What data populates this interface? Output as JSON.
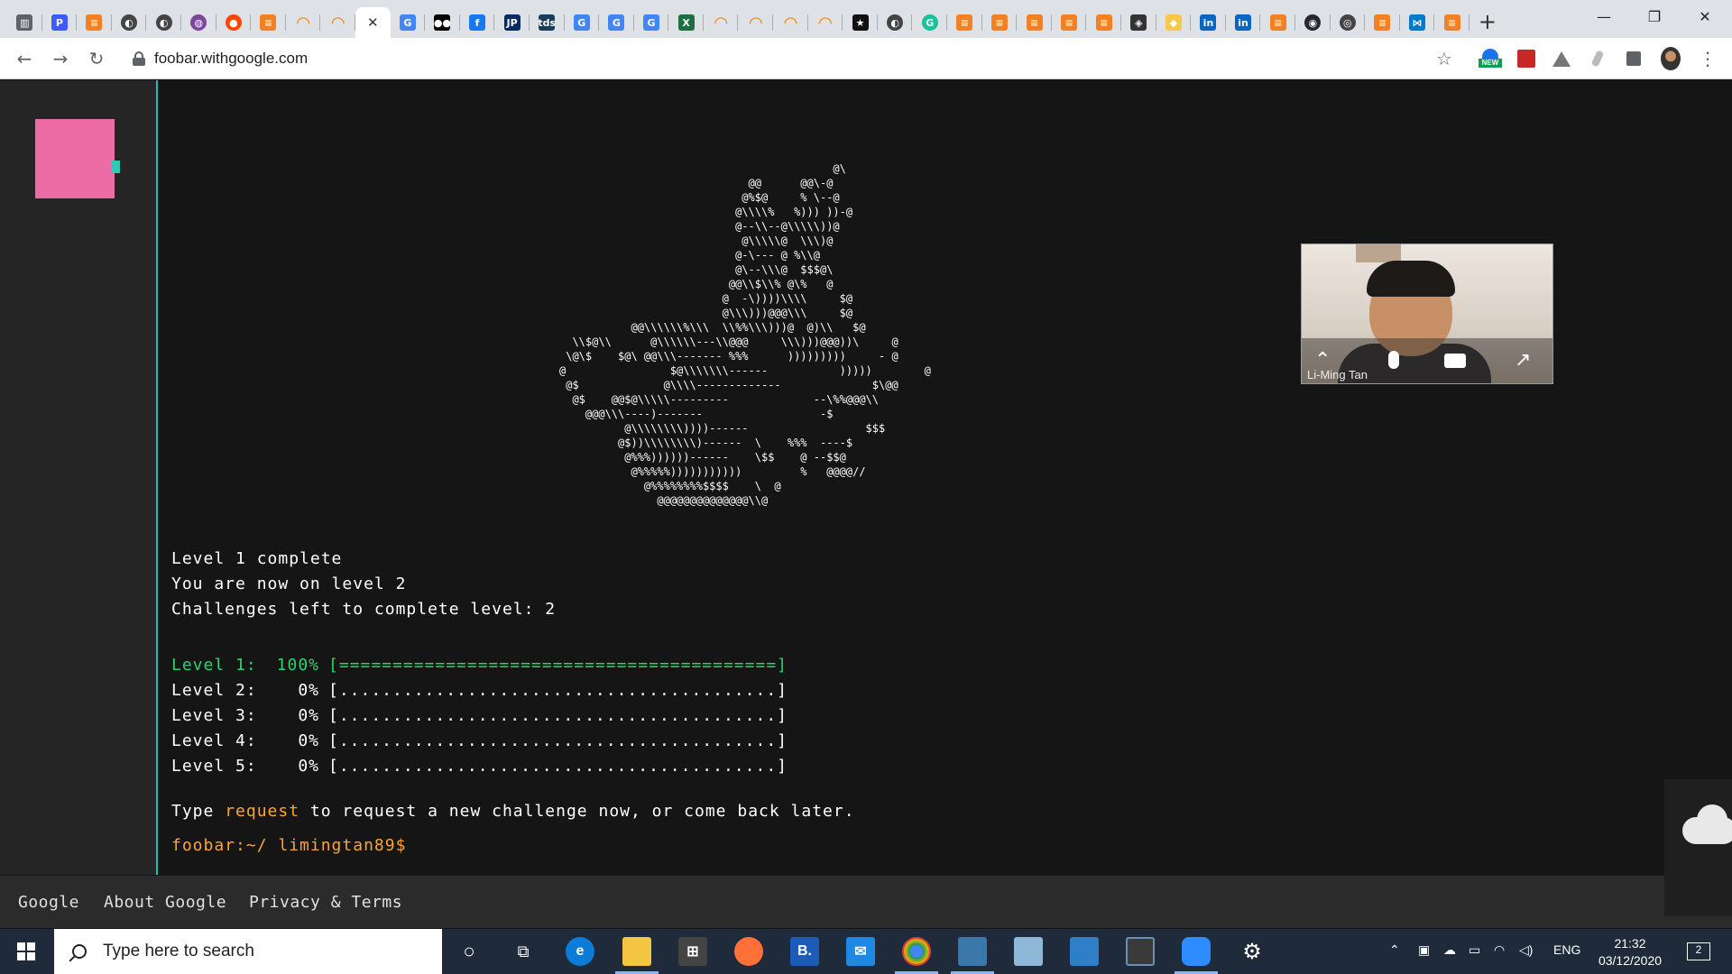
{
  "browser": {
    "url": "foobar.withgoogle.com",
    "active_tab_close": "✕",
    "new_tab": "+",
    "tabs": [
      {
        "icon": "reader-mode-icon",
        "glyph": "▥",
        "color": "#5f6368"
      },
      {
        "icon": "p-icon",
        "glyph": "P",
        "color": "#3d5afe"
      },
      {
        "icon": "stackoverflow-icon",
        "glyph": "≡",
        "color": "#f48024"
      },
      {
        "icon": "globe-icon",
        "glyph": "◐",
        "color": "#444444"
      },
      {
        "icon": "globe-icon",
        "glyph": "◐",
        "color": "#444444"
      },
      {
        "icon": "tor-icon",
        "glyph": "◍",
        "color": "#7d4698"
      },
      {
        "icon": "reddit-icon",
        "glyph": "●",
        "color": "#ff4500"
      },
      {
        "icon": "stackoverflow-icon",
        "glyph": "≡",
        "color": "#f48024"
      },
      {
        "icon": "loading-icon",
        "glyph": "◠",
        "color": "#f57c00"
      },
      {
        "icon": "loading-icon",
        "glyph": "◠",
        "color": "#f57c00"
      },
      {
        "icon": "active-tab",
        "glyph": "",
        "color": "#ffffff"
      },
      {
        "icon": "google-icon",
        "glyph": "G",
        "color": "#4285f4"
      },
      {
        "icon": "medium-icon",
        "glyph": "●●",
        "color": "#000000"
      },
      {
        "icon": "facebook-icon",
        "glyph": "f",
        "color": "#1877f2"
      },
      {
        "icon": "jp-icon",
        "glyph": "JP",
        "color": "#0a2a66"
      },
      {
        "icon": "tds-icon",
        "glyph": "tds",
        "color": "#1c3d5a"
      },
      {
        "icon": "google-icon",
        "glyph": "G",
        "color": "#4285f4"
      },
      {
        "icon": "google-icon",
        "glyph": "G",
        "color": "#4285f4"
      },
      {
        "icon": "google-icon",
        "glyph": "G",
        "color": "#4285f4"
      },
      {
        "icon": "excel-icon",
        "glyph": "X",
        "color": "#1d6f42"
      },
      {
        "icon": "loading-icon",
        "glyph": "◠",
        "color": "#f57c00"
      },
      {
        "icon": "loading-icon",
        "glyph": "◠",
        "color": "#f57c00"
      },
      {
        "icon": "loading-icon",
        "glyph": "◠",
        "color": "#f57c00"
      },
      {
        "icon": "loading-icon",
        "glyph": "◠",
        "color": "#f57c00"
      },
      {
        "icon": "star-icon",
        "glyph": "★",
        "color": "#111111"
      },
      {
        "icon": "globe-icon",
        "glyph": "◐",
        "color": "#444444"
      },
      {
        "icon": "grammarly-icon",
        "glyph": "G",
        "color": "#15c39a"
      },
      {
        "icon": "stackoverflow-icon",
        "glyph": "≡",
        "color": "#f48024"
      },
      {
        "icon": "stackoverflow-icon",
        "glyph": "≡",
        "color": "#f48024"
      },
      {
        "icon": "stackoverflow-icon",
        "glyph": "≡",
        "color": "#f48024"
      },
      {
        "icon": "stackoverflow-icon",
        "glyph": "≡",
        "color": "#f48024"
      },
      {
        "icon": "stackoverflow-icon",
        "glyph": "≡",
        "color": "#f48024"
      },
      {
        "icon": "diamond-icon",
        "glyph": "◈",
        "color": "#333333"
      },
      {
        "icon": "python-icon",
        "glyph": "◆",
        "color": "#f7c948"
      },
      {
        "icon": "linkedin-icon",
        "glyph": "in",
        "color": "#0a66c2"
      },
      {
        "icon": "linkedin-icon",
        "glyph": "in",
        "color": "#0a66c2"
      },
      {
        "icon": "stackoverflow-icon",
        "glyph": "≡",
        "color": "#f48024"
      },
      {
        "icon": "github-icon",
        "glyph": "◉",
        "color": "#24292e"
      },
      {
        "icon": "spiral-icon",
        "glyph": "◎",
        "color": "#444444"
      },
      {
        "icon": "stackoverflow-icon",
        "glyph": "≡",
        "color": "#f48024"
      },
      {
        "icon": "vscode-icon",
        "glyph": "⋈",
        "color": "#007acc"
      },
      {
        "icon": "stackoverflow-icon",
        "glyph": "≡",
        "color": "#f48024"
      }
    ],
    "window_controls": {
      "minimize": "—",
      "restore": "❐",
      "close": "✕"
    }
  },
  "toolbar": {
    "back": "←",
    "forward": "→",
    "reload": "↻",
    "star": "☆",
    "ext_new_badge": "NEW",
    "menu": "⋮"
  },
  "terminal": {
    "ascii_art": "                                          @\\\n                             @@      @@\\-@\n                            @%$@     % \\--@\n                           @\\\\\\\\%   %))) ))-@\n                           @--\\\\--@\\\\\\\\\\))@\n                            @\\\\\\\\\\@  \\\\\\)@\n                           @-\\--- @ %\\\\@\n                           @\\--\\\\\\@  $$$@\\\n                          @@\\\\$\\\\% @\\%   @\n                         @  -\\))))\\\\\\\\     $@\n                         @\\\\\\)))@@@\\\\\\     $@\n           @@\\\\\\\\\\\\%\\\\\\  \\\\%%\\\\\\)))@  @)\\\\   $@\n  \\\\$@\\\\      @\\\\\\\\\\\\---\\\\@@@     \\\\\\)))@@@))\\     @\n \\@\\$    $@\\ @@\\\\\\------- %%%      )))))))))     - @\n@                $@\\\\\\\\\\\\\\------           )))))        @\n @$             @\\\\\\\\-------------              $\\@@\n  @$    @@$@\\\\\\\\\\---------             --\\%%@@@\\\\\n    @@@\\\\\\----)-------                  -$\n          @\\\\\\\\\\\\\\\\))))------                  $$$\n         @$))\\\\\\\\\\\\\\\\)------  \\    %%%  ----$\n          @%%%))))))------    \\$$    @ --$$@\n           @%%%%%)))))))))))         %   @@@@//\n             @%%%%%%%%$$$$    \\  @\n               @@@@@@@@@@@@@@\\\\@",
    "lines": {
      "l1": "Level 1 complete",
      "l2": "You are now on level 2",
      "l3": "Challenges left to complete level: 2"
    },
    "levels": [
      {
        "label": "Level 1:",
        "percent": "100%",
        "bar": "[=========================================]",
        "progress": 1.0
      },
      {
        "label": "Level 2:",
        "percent": "0%",
        "bar": "[.........................................]",
        "progress": 0.0
      },
      {
        "label": "Level 3:",
        "percent": "0%",
        "bar": "[.........................................]",
        "progress": 0.0
      },
      {
        "label": "Level 4:",
        "percent": "0%",
        "bar": "[.........................................]",
        "progress": 0.0
      },
      {
        "label": "Level 5:",
        "percent": "0%",
        "bar": "[.........................................]",
        "progress": 0.0
      }
    ],
    "type_prefix": "Type ",
    "type_command": "request",
    "type_suffix": " to request a new challenge now, or come back later.",
    "prompt": "foobar:~/ limingtan89$"
  },
  "footer": {
    "google": "Google",
    "about": "About Google",
    "privacy": "Privacy & Terms"
  },
  "video_call": {
    "name": "Li-Ming Tan"
  },
  "taskbar": {
    "search_placeholder": "Type here to search",
    "language": "ENG",
    "time": "21:32",
    "date": "03/12/2020",
    "notification_count": "2"
  },
  "colors": {
    "accent_teal": "#20c0b0",
    "pink_block": "#ee6ca6",
    "progress_green": "#2bd46a",
    "command_orange": "#ffa52c"
  }
}
